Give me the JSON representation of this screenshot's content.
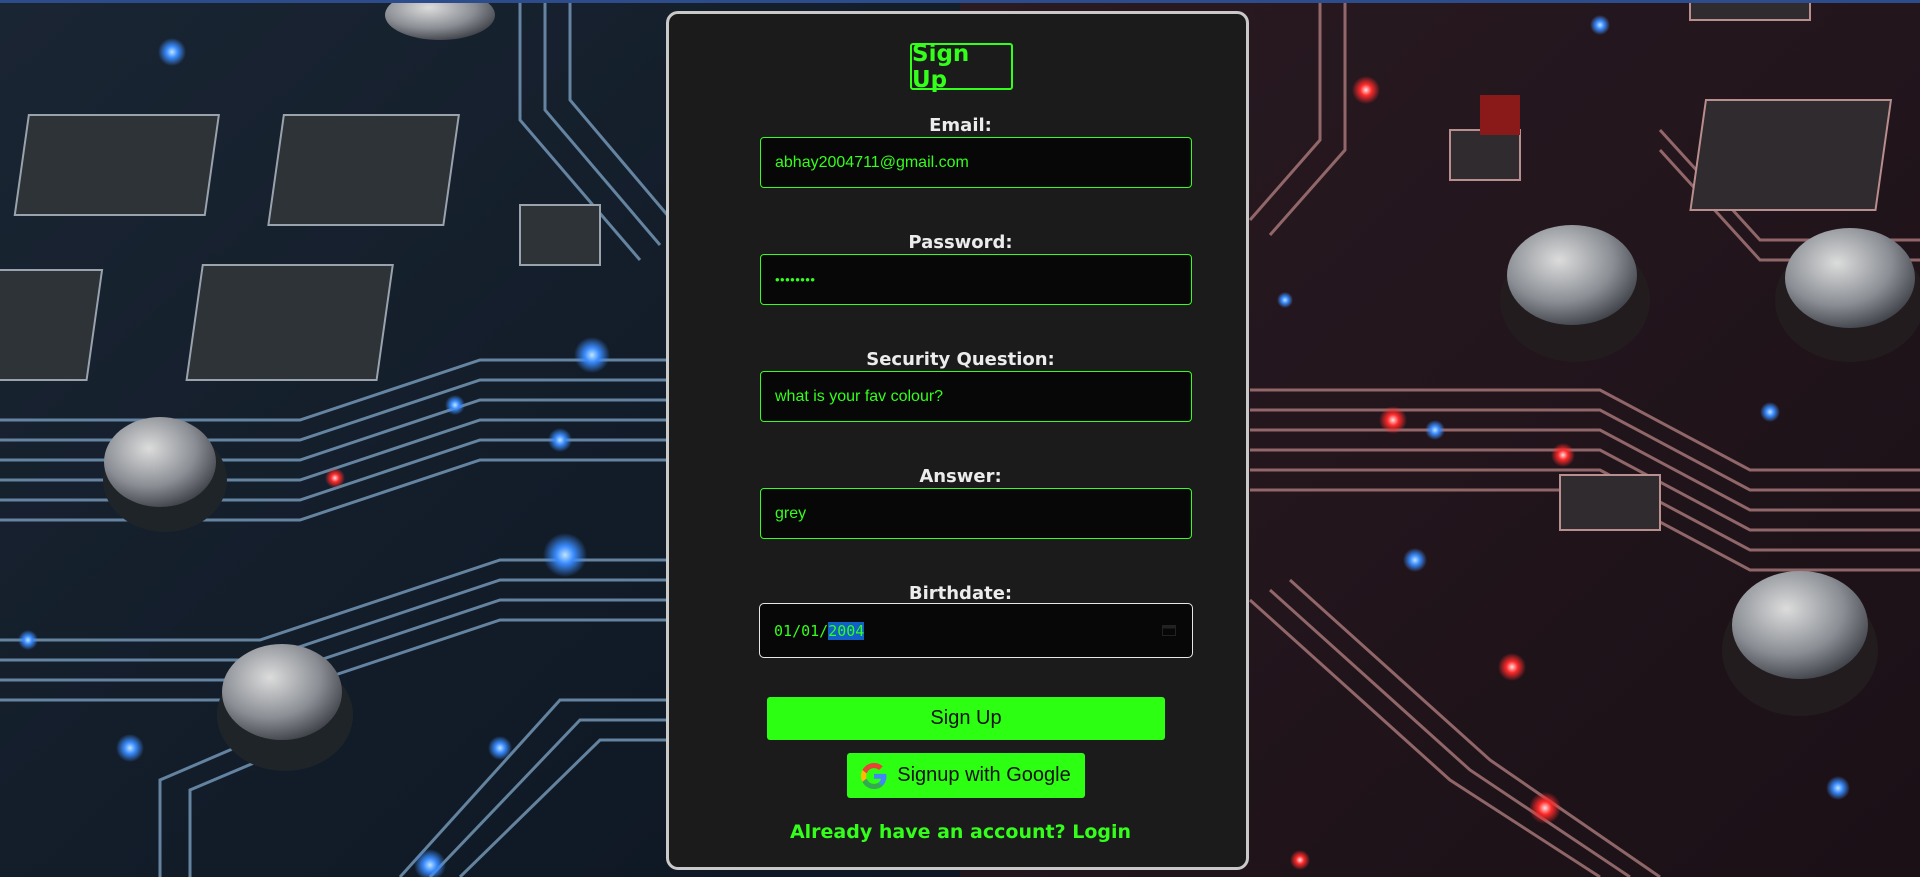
{
  "form": {
    "title": "Sign Up",
    "email_label": "Email:",
    "email_value": "abhay2004711@gmail.com",
    "password_label": "Password:",
    "password_value": "••••••••",
    "question_label": "Security Question:",
    "question_value": "what is your fav colour?",
    "answer_label": "Answer:",
    "answer_value": "grey",
    "birthdate_label": "Birthdate:",
    "birthdate": {
      "month": "01",
      "day": "01",
      "year": "2004",
      "separator": "/"
    },
    "signup_button": "Sign Up",
    "google_button": "Signup with Google",
    "login_prompt": "Already have an account?",
    "login_link": "Login"
  },
  "icons": {
    "google": "google-icon",
    "calendar": "calendar-icon"
  },
  "colors": {
    "accent": "#2dff12",
    "card_background": "#1b1b1b",
    "field_background": "#070707",
    "label_text": "#ececec",
    "date_selection": "#1060c8"
  }
}
